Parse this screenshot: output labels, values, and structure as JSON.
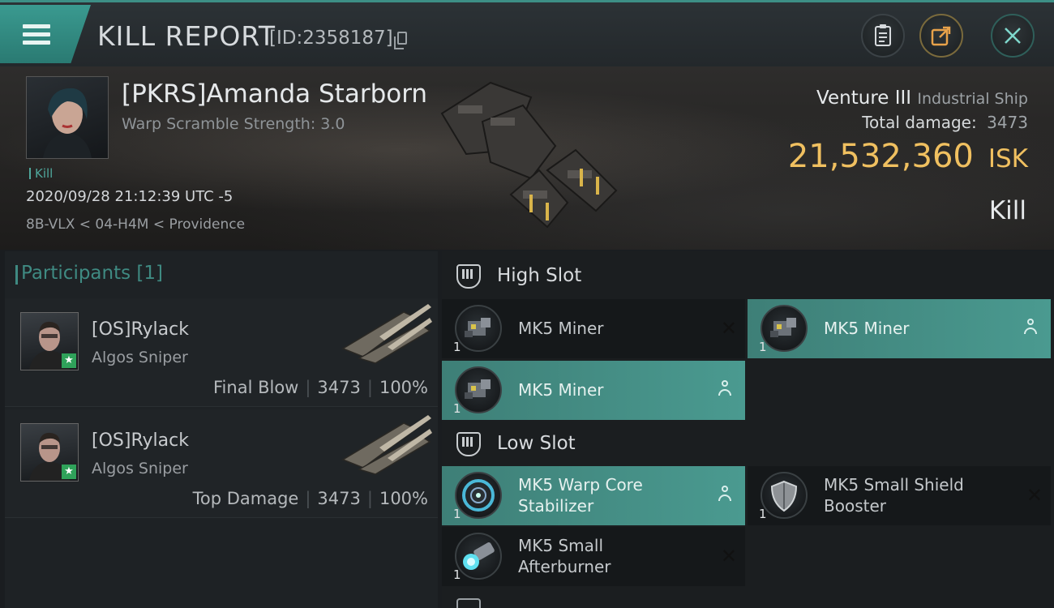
{
  "topbar": {
    "title": "KILL REPORT",
    "report_id": "[ID:2358187]",
    "icons": [
      "menu-icon",
      "copy-icon",
      "clipboard-icon",
      "share-icon",
      "close-icon"
    ]
  },
  "victim": {
    "name": "[PKRS]Amanda Starborn",
    "warp_scramble": "Warp Scramble Strength: 3.0",
    "tag": "Kill",
    "time": "2020/09/28 21:12:39 UTC -5",
    "location": "8B-VLX < 04-H4M < Providence"
  },
  "ship": {
    "name": "Venture III",
    "class": "Industrial Ship",
    "total_damage_label": "Total damage:",
    "total_damage": "3473",
    "isk_value": "21,532,360",
    "isk_unit": "ISK",
    "result": "Kill"
  },
  "participants": {
    "title": "Participants [1]",
    "items": [
      {
        "name": "[OS]Rylack",
        "ship": "Algos Sniper",
        "role": "Final Blow",
        "damage": "3473",
        "percent": "100%"
      },
      {
        "name": "[OS]Rylack",
        "ship": "Algos Sniper",
        "role": "Top Damage",
        "damage": "3473",
        "percent": "100%"
      }
    ]
  },
  "slots": {
    "high": {
      "label": "High Slot",
      "modules": [
        {
          "name": "MK5 Miner",
          "qty": "1",
          "state": "destroyed"
        },
        {
          "name": "MK5 Miner",
          "qty": "1",
          "state": "dropped"
        },
        {
          "name": "MK5 Miner",
          "qty": "1",
          "state": "dropped"
        }
      ]
    },
    "low": {
      "label": "Low Slot",
      "modules": [
        {
          "name_line1": "MK5 Warp Core",
          "name_line2": "Stabilizer",
          "qty": "1",
          "state": "dropped"
        },
        {
          "name_line1": "MK5 Small Shield",
          "name_line2": "Booster",
          "qty": "1",
          "state": "destroyed"
        },
        {
          "name_line1": "MK5 Small",
          "name_line2": "Afterburner",
          "qty": "1",
          "state": "destroyed"
        }
      ]
    }
  },
  "colors": {
    "accent_teal": "#3e8f86",
    "isk_gold": "#f0c060",
    "star_green": "#2fa25a"
  }
}
